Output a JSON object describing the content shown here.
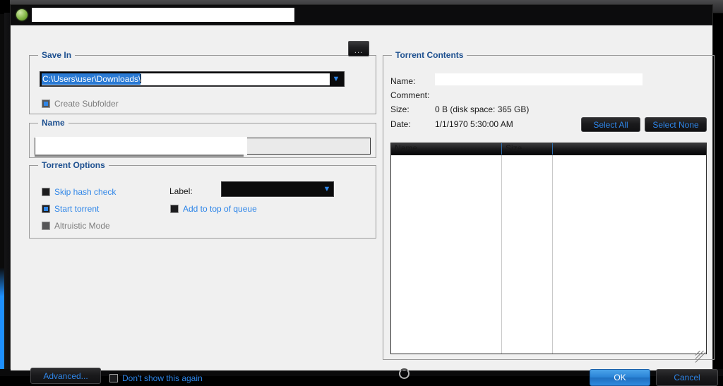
{
  "window": {
    "app_icon": "utorrent-green-circle-icon",
    "title_redacted": true
  },
  "save_in": {
    "group_title": "Save In",
    "path_value": "C:\\Users\\user\\Downloads\\",
    "dropdown_icon": "chevron-down-icon",
    "browse_label": "...",
    "create_subfolder": {
      "label": "Create Subfolder",
      "checked": false,
      "enabled": false
    }
  },
  "name_group": {
    "group_title": "Name",
    "value": ""
  },
  "torrent_options": {
    "group_title": "Torrent Options",
    "skip_hash_check": {
      "label": "Skip hash check",
      "checked": false
    },
    "start_torrent": {
      "label": "Start torrent",
      "checked": true
    },
    "altruistic_mode": {
      "label": "Altruistic Mode",
      "checked": false,
      "enabled": false
    },
    "add_to_top_of_queue": {
      "label": "Add to top of queue",
      "checked": false
    },
    "label_caption": "Label:",
    "label_value": "",
    "label_dropdown_icon": "chevron-down-icon"
  },
  "torrent_contents": {
    "group_title": "Torrent Contents",
    "name_key": "Name:",
    "name_value": "",
    "comment_key": "Comment:",
    "comment_value": "",
    "size_key": "Size:",
    "size_value": "0 B (disk space: 365 GB)",
    "date_key": "Date:",
    "date_value": "1/1/1970 5:30:00 AM",
    "select_all_label": "Select All",
    "select_none_label": "Select None",
    "columns": [
      "Name",
      "Size",
      ""
    ],
    "rows": []
  },
  "footer": {
    "advanced_label": "Advanced...",
    "dont_show_again": {
      "label": "Don't show this again",
      "checked": false
    },
    "spinner_icon": "loading-spinner-icon",
    "ok_label": "OK",
    "cancel_label": "Cancel"
  },
  "colors": {
    "dialog_bg": "#f0f0f0",
    "group_title": "#1c4f8f",
    "link_blue": "#2f86e8",
    "accent_blue": "#2a7ad4",
    "ok_button": "#2b84d6",
    "dark_control": "#0b0b0c"
  }
}
